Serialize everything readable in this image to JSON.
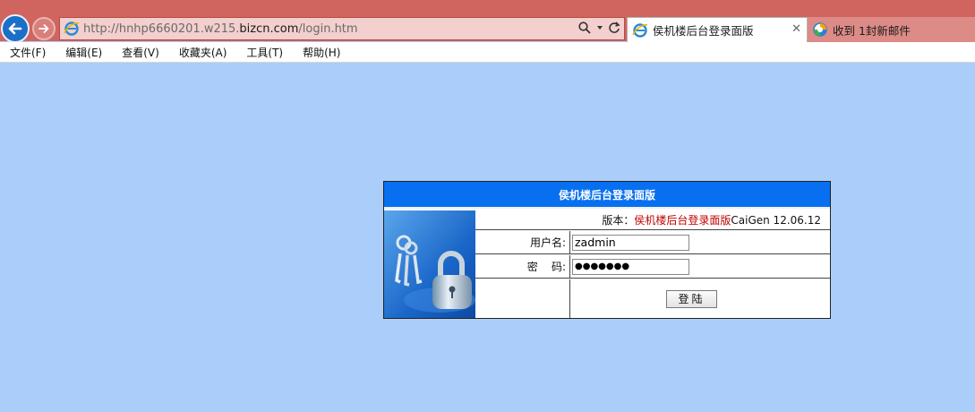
{
  "browser": {
    "address": {
      "url_prefix": "http://hnhp6660201.w215.",
      "url_domain": "bizcn.com",
      "url_suffix": "/login.htm"
    },
    "tabs": [
      {
        "label": "侯机楼后台登录面版",
        "active": true
      },
      {
        "label": "收到 1封新邮件",
        "active": false
      }
    ],
    "menu": [
      "文件(F)",
      "编辑(E)",
      "查看(V)",
      "收藏夹(A)",
      "工具(T)",
      "帮助(H)"
    ]
  },
  "login": {
    "title": "侯机楼后台登录面版",
    "version_label": "版本：",
    "version_name": "侯机楼后台登录面版",
    "version_suffix": "CaiGen 12.06.12",
    "username_label": "用户名:",
    "username_value": "zadmin",
    "password_label": "密    码:",
    "password_mask": "●●●●●●●",
    "submit_label": "登陆"
  },
  "colors": {
    "page_bg": "#abcdfa",
    "header_bg": "#0870f0",
    "titlebar": "#d0645f",
    "version_red": "#c00000"
  }
}
